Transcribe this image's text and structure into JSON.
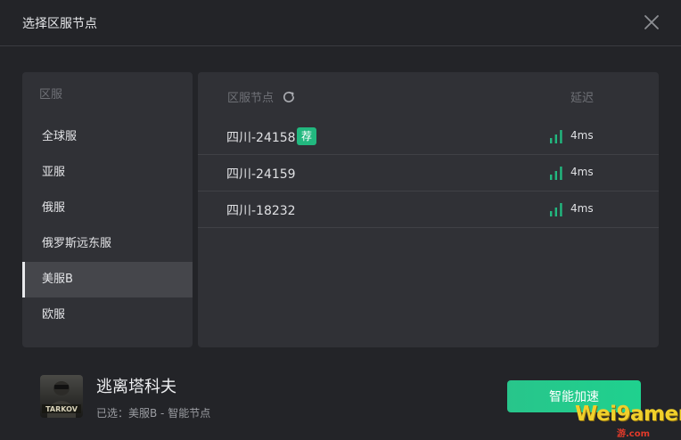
{
  "dialog": {
    "title": "选择区服节点"
  },
  "regions": {
    "header": "区服",
    "items": [
      {
        "label": "全球服"
      },
      {
        "label": "亚服"
      },
      {
        "label": "俄服"
      },
      {
        "label": "俄罗斯远东服"
      },
      {
        "label": "美服B",
        "active": true
      },
      {
        "label": "欧服"
      }
    ]
  },
  "nodes": {
    "header": "区服节点",
    "latency_header": "延迟",
    "items": [
      {
        "name": "四川-24158",
        "badge": "荐",
        "ping": "4ms",
        "signal_bars": 3
      },
      {
        "name": "四川-24159",
        "badge": "",
        "ping": "4ms",
        "signal_bars": 3
      },
      {
        "name": "四川-18232",
        "badge": "",
        "ping": "4ms",
        "signal_bars": 3
      }
    ]
  },
  "game": {
    "name": "逃离塔科夫",
    "icon_label": "TARKOV",
    "selection": "已选：美服B - 智能节点"
  },
  "actions": {
    "accelerate_label": "智能加速"
  },
  "watermark": {
    "text": "Wei9amer",
    "sub": "游.com"
  },
  "colors": {
    "accent": "#22b87f",
    "signal": "#22b87f",
    "background": "#232428",
    "panel": "#303136"
  }
}
